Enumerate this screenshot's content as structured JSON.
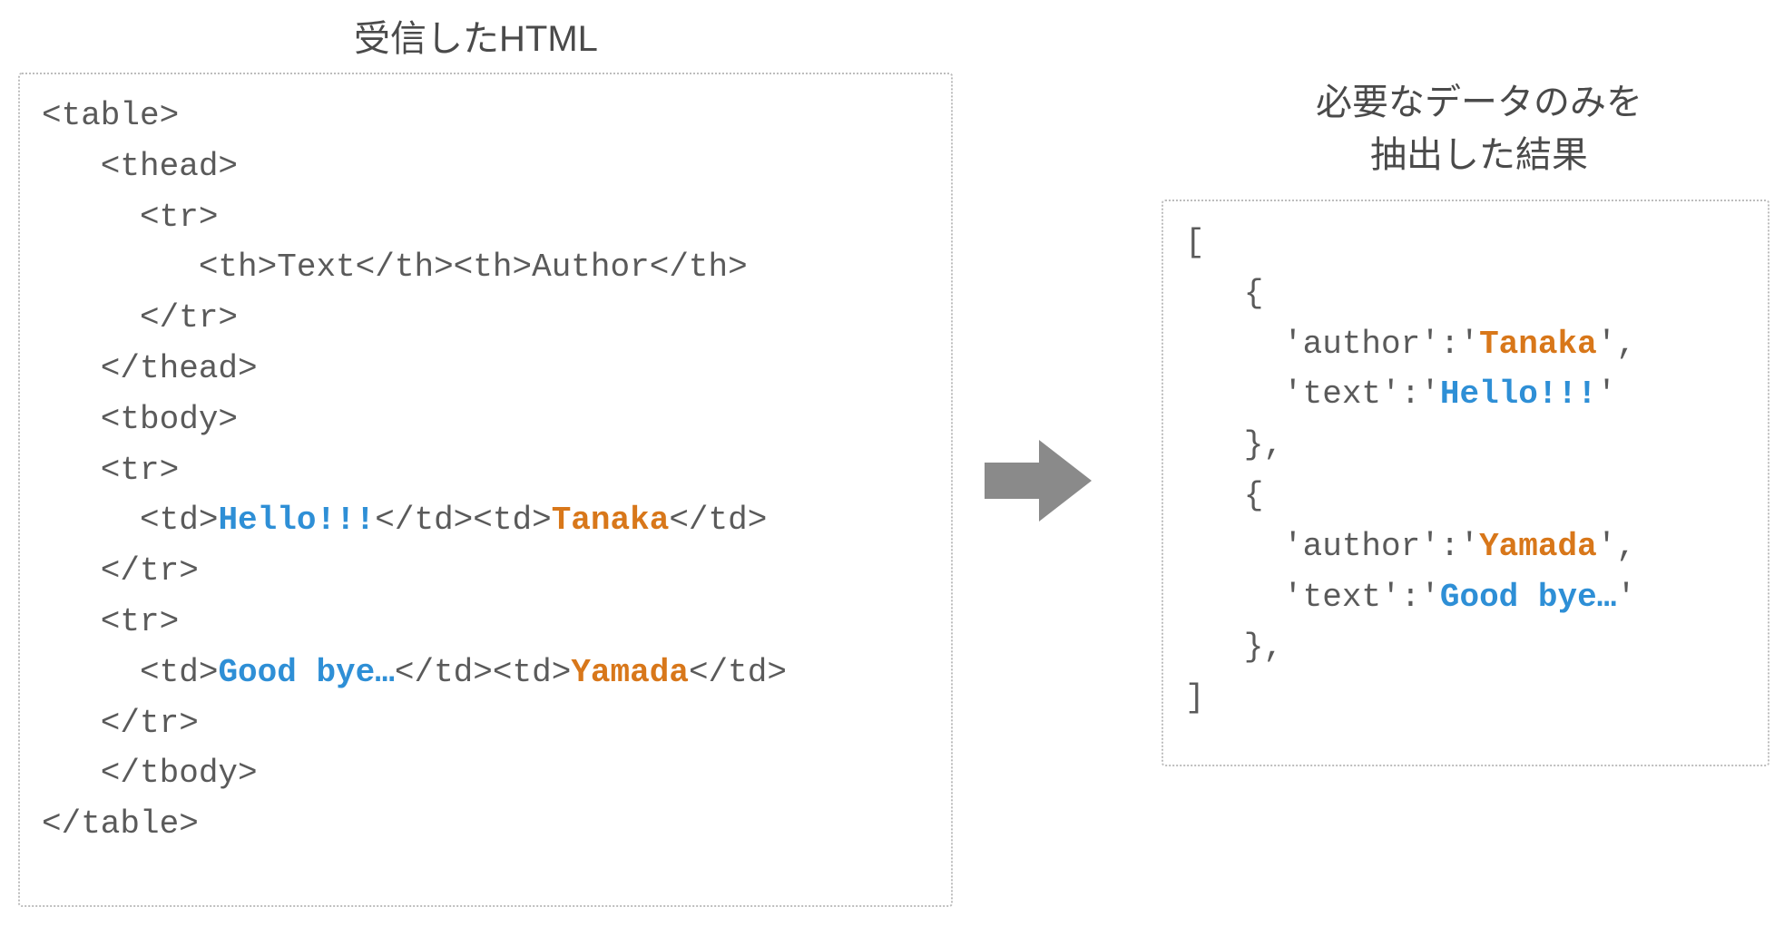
{
  "headings": {
    "left": "受信したHTML",
    "right_line1": "必要なデータのみを",
    "right_line2": "抽出した結果"
  },
  "left_code": {
    "l01": "<table>",
    "l02": "   <thead>",
    "l03": "     <tr>",
    "l04": "        <th>Text</th><th>Author</th>",
    "l05": "     </tr>",
    "l06": "   </thead>",
    "l07": "   <tbody>",
    "l08": "   <tr>",
    "l09a": "     <td>",
    "l09b": "Hello!!!",
    "l09c": "</td><td>",
    "l09d": "Tanaka",
    "l09e": "</td>",
    "l10": "   </tr>",
    "l11": "   <tr>",
    "l12a": "     <td>",
    "l12b": "Good bye…",
    "l12c": "</td><td>",
    "l12d": "Yamada",
    "l12e": "</td>",
    "l13": "   </tr>",
    "l14": "   </tbody>",
    "l15": "</table>"
  },
  "right_code": {
    "r01": "[",
    "r02": "   {",
    "r03a": "     'author':'",
    "r03b": "Tanaka",
    "r03c": "',",
    "r04a": "     'text':'",
    "r04b": "Hello!!!",
    "r04c": "'",
    "r05": "   },",
    "r06": "   {",
    "r07a": "     'author':'",
    "r07b": "Yamada",
    "r07c": "',",
    "r08a": "     'text':'",
    "r08b": "Good bye…",
    "r08c": "'",
    "r09": "   },",
    "r10": "]"
  },
  "colors": {
    "text_highlight": "#2e8fd6",
    "author_highlight": "#d8771a",
    "code_gray": "#5a5a5a",
    "arrow_fill": "#8a8a8a"
  }
}
